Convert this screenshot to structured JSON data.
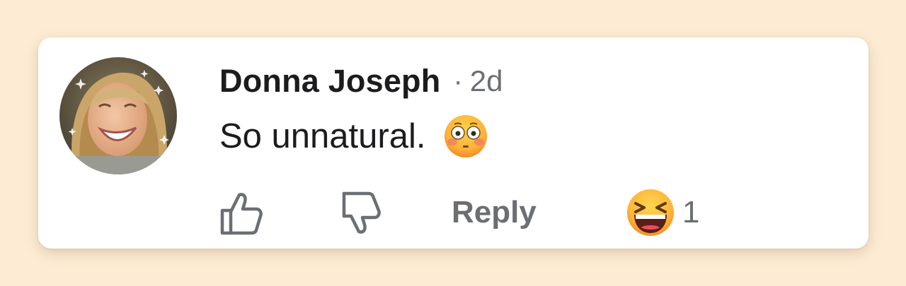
{
  "comment": {
    "author": "Donna Joseph",
    "separator": "·",
    "time_ago": "2d",
    "text": "So unnatural.",
    "text_emoji": "flushed-face-emoji"
  },
  "actions": {
    "like_icon": "thumbs-up-icon",
    "dislike_icon": "thumbs-down-icon",
    "reply_label": "Reply",
    "reaction_emoji": "grinning-squinting-face-emoji",
    "reaction_count": "1"
  },
  "colors": {
    "background": "#fdebd3",
    "card": "#ffffff",
    "primary_text": "#1c1c1e",
    "secondary_text": "#6b6e73"
  }
}
